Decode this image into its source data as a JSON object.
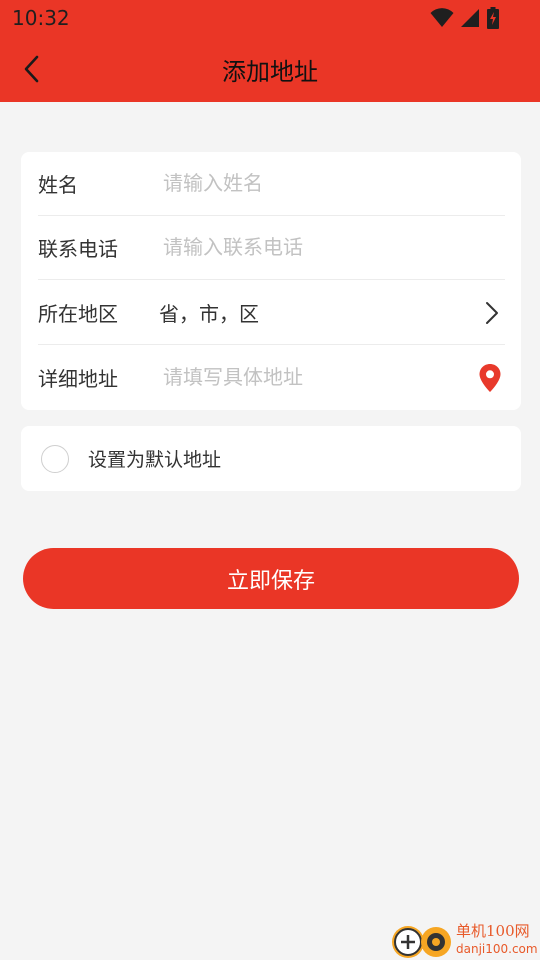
{
  "status_bar": {
    "time": "10:32"
  },
  "header": {
    "title": "添加地址"
  },
  "form": {
    "name": {
      "label": "姓名",
      "placeholder": "请输入姓名",
      "value": ""
    },
    "phone": {
      "label": "联系电话",
      "placeholder": "请输入联系电话",
      "value": ""
    },
    "region": {
      "label": "所在地区",
      "value": "省，市，区"
    },
    "detail": {
      "label": "详细地址",
      "placeholder": "请填写具体地址",
      "value": ""
    }
  },
  "default_option": {
    "label": "设置为默认地址",
    "checked": false
  },
  "save_button": {
    "label": "立即保存"
  },
  "watermark": {
    "name": "单机100网",
    "url": "danji100.com"
  },
  "colors": {
    "accent": "#ea3626",
    "background": "#f4f4f4",
    "placeholder": "#c2c2c2",
    "pin": "#e8392b"
  }
}
